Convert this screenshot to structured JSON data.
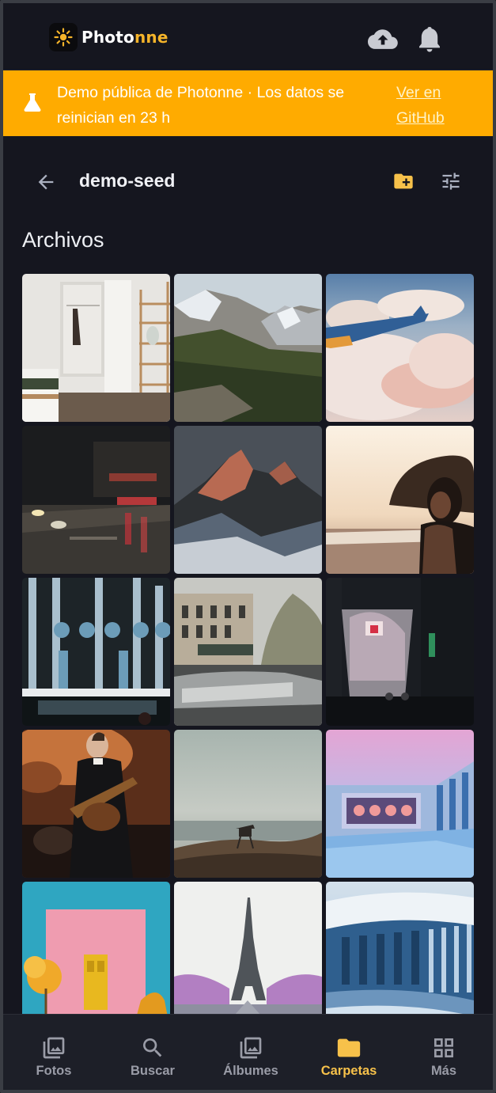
{
  "header": {
    "brand_part1": "Photo",
    "brand_part2": "nne",
    "logo_icon": "sun-logo-icon",
    "upload_icon": "cloud-upload-icon",
    "notifications_icon": "bell-icon"
  },
  "banner": {
    "icon": "flask-icon",
    "text": "Demo pública de Photonne · Los datos se reinician en 23 h",
    "link": "Ver en GitHub",
    "color": "#ffab00"
  },
  "folder": {
    "back_icon": "arrow-left-icon",
    "name": "demo-seed",
    "new_folder_icon": "folder-plus-icon",
    "filter_icon": "tune-icon"
  },
  "section": {
    "title": "Archivos"
  },
  "photos": [
    "bedroom-wardrobe-shelves",
    "snowy-mountains-forest",
    "airplane-wing-over-clouds",
    "city-street-at-night",
    "mountain-peak-at-sunset",
    "woman-on-beach-sunset",
    "industrial-pipes-facade",
    "paris-street-blurred-car",
    "neon-alley-at-dusk",
    "guitarist-in-tuxedo",
    "lifeguard-tower-seaside",
    "pastel-pool-building",
    "pink-house-yellow-door",
    "eiffel-tower-pink-trees",
    "blue-modern-architecture"
  ],
  "bottom_nav": {
    "items": [
      {
        "label": "Fotos",
        "icon": "photo-icon"
      },
      {
        "label": "Buscar",
        "icon": "search-icon"
      },
      {
        "label": "Álbumes",
        "icon": "albums-icon"
      },
      {
        "label": "Carpetas",
        "icon": "folder-icon",
        "active": true
      },
      {
        "label": "Más",
        "icon": "grid-icon"
      }
    ],
    "active_color": "#f7c14a"
  }
}
